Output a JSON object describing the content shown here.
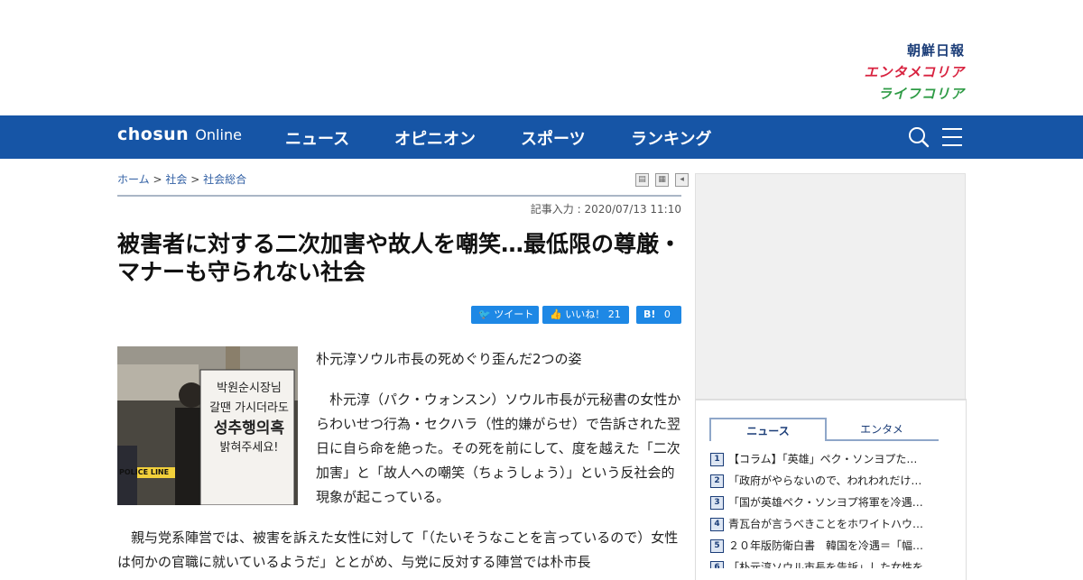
{
  "brands": {
    "a": "朝鮮日報",
    "b": "エンタメコリア",
    "c": "ライフコリア"
  },
  "nav": {
    "logo_main": "chosun",
    "logo_sub": "Online",
    "items": [
      "ニュース",
      "オピニオン",
      "スポーツ",
      "ランキング"
    ],
    "search_icon": "search-icon",
    "menu_icon": "hamburger-icon"
  },
  "breadcrumb": {
    "home": "ホーム",
    "sep": ">",
    "section": "社会",
    "subsection": "社会総合"
  },
  "article": {
    "date": "記事入力 : 2020/07/13 11:10",
    "title": "被害者に対する二次加害や故人を嘲笑…最低限の尊厳・マナーも守られない社会",
    "subhead": "朴元淳ソウル市長の死めぐり歪んだ2つの姿",
    "body1": "　朴元淳（パク・ウォンスン）ソウル市長が元秘書の女性からわいせつ行為・セクハラ（性的嫌がらせ）で告訴された翌日に自ら命を絶った。その死を前にして、度を越えた「二次加害」と「故人への嘲笑（ちょうしょう）」という反社会的現象が起こっている。",
    "body2": "　親与党系陣営では、被害を訴えた女性に対して「（たいそうなことを言っているので）女性は何かの官職に就いているようだ」ととがめ、与党に反対する陣営では朴市長",
    "photo_sign": [
      "박원순시장님",
      "갈땐 가시더라도",
      "성추행의혹",
      "밝혀주세요!"
    ],
    "photo_tape": "POLICE LINE"
  },
  "share": {
    "tweet": "ツイート",
    "like": "いいね！",
    "like_count": "21",
    "hatena": "B!",
    "hatena_count": "0"
  },
  "sidebar": {
    "tabs": [
      "ニュース",
      "エンタメ"
    ],
    "ranking": [
      {
        "num": "1",
        "text": "【コラム】「英雄」ペク・ソンヨプた…"
      },
      {
        "num": "2",
        "text": "「政府がやらないので、われわれだけ…"
      },
      {
        "num": "3",
        "text": "「国が英雄ペク・ソンヨプ将軍を冷遇…"
      },
      {
        "num": "4",
        "text": "青瓦台が言うべきことをホワイトハウ…"
      },
      {
        "num": "5",
        "text": "２０年版防衛白書　韓国を冷遇＝「幅…"
      },
      {
        "num": "6",
        "text": "「朴元淳ソウル市長を告訴」した女性を…"
      }
    ]
  }
}
